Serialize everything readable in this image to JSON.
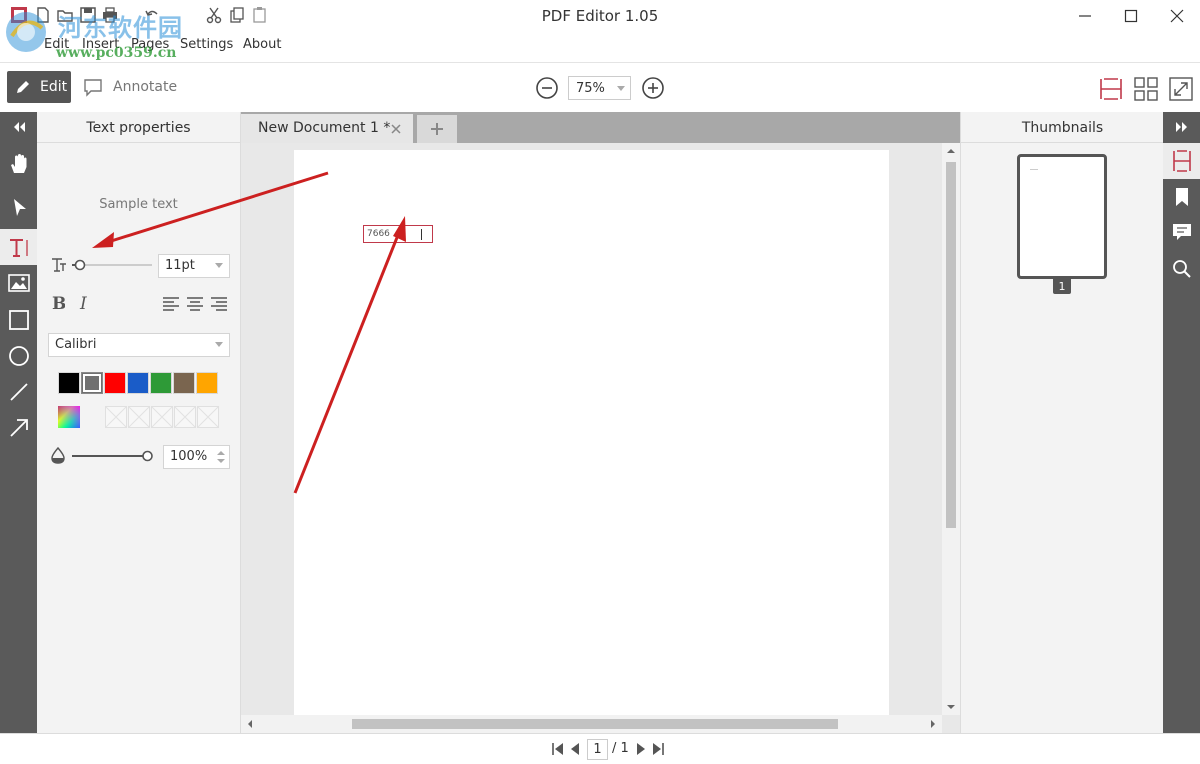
{
  "window": {
    "title": "PDF Editor 1.05"
  },
  "watermark": {
    "title": "河东软件园",
    "url": "www.pc0359.cn"
  },
  "menu": {
    "items": [
      {
        "label": "Edit"
      },
      {
        "label": "Insert"
      },
      {
        "label": "Pages"
      },
      {
        "label": "Settings"
      },
      {
        "label": "About"
      }
    ]
  },
  "toolbar": {
    "edit_label": "Edit",
    "annotate_label": "Annotate",
    "zoom": "75%"
  },
  "props": {
    "title": "Text properties",
    "sample": "Sample text",
    "font_size": "11pt",
    "font_family": "Calibri",
    "opacity": "100%",
    "font_size_slider_fraction": 0.1,
    "opacity_slider_fraction": 1.0,
    "colors": [
      "#000000",
      "#707070",
      "#ff0000",
      "#1a5cc8",
      "#2e9a37",
      "#7a654f",
      "#ffa500"
    ],
    "selected_color": "#707070"
  },
  "document": {
    "tab_label": "New Document 1 *",
    "textbox_value": "7666"
  },
  "thumbnails": {
    "title": "Thumbnails",
    "page_number": "1"
  },
  "pager": {
    "current": "1",
    "total": "/ 1"
  },
  "colors": {
    "accent": "#c0394a",
    "strip": "#5a5a5a",
    "annotation_arrow": "#cc2020"
  }
}
